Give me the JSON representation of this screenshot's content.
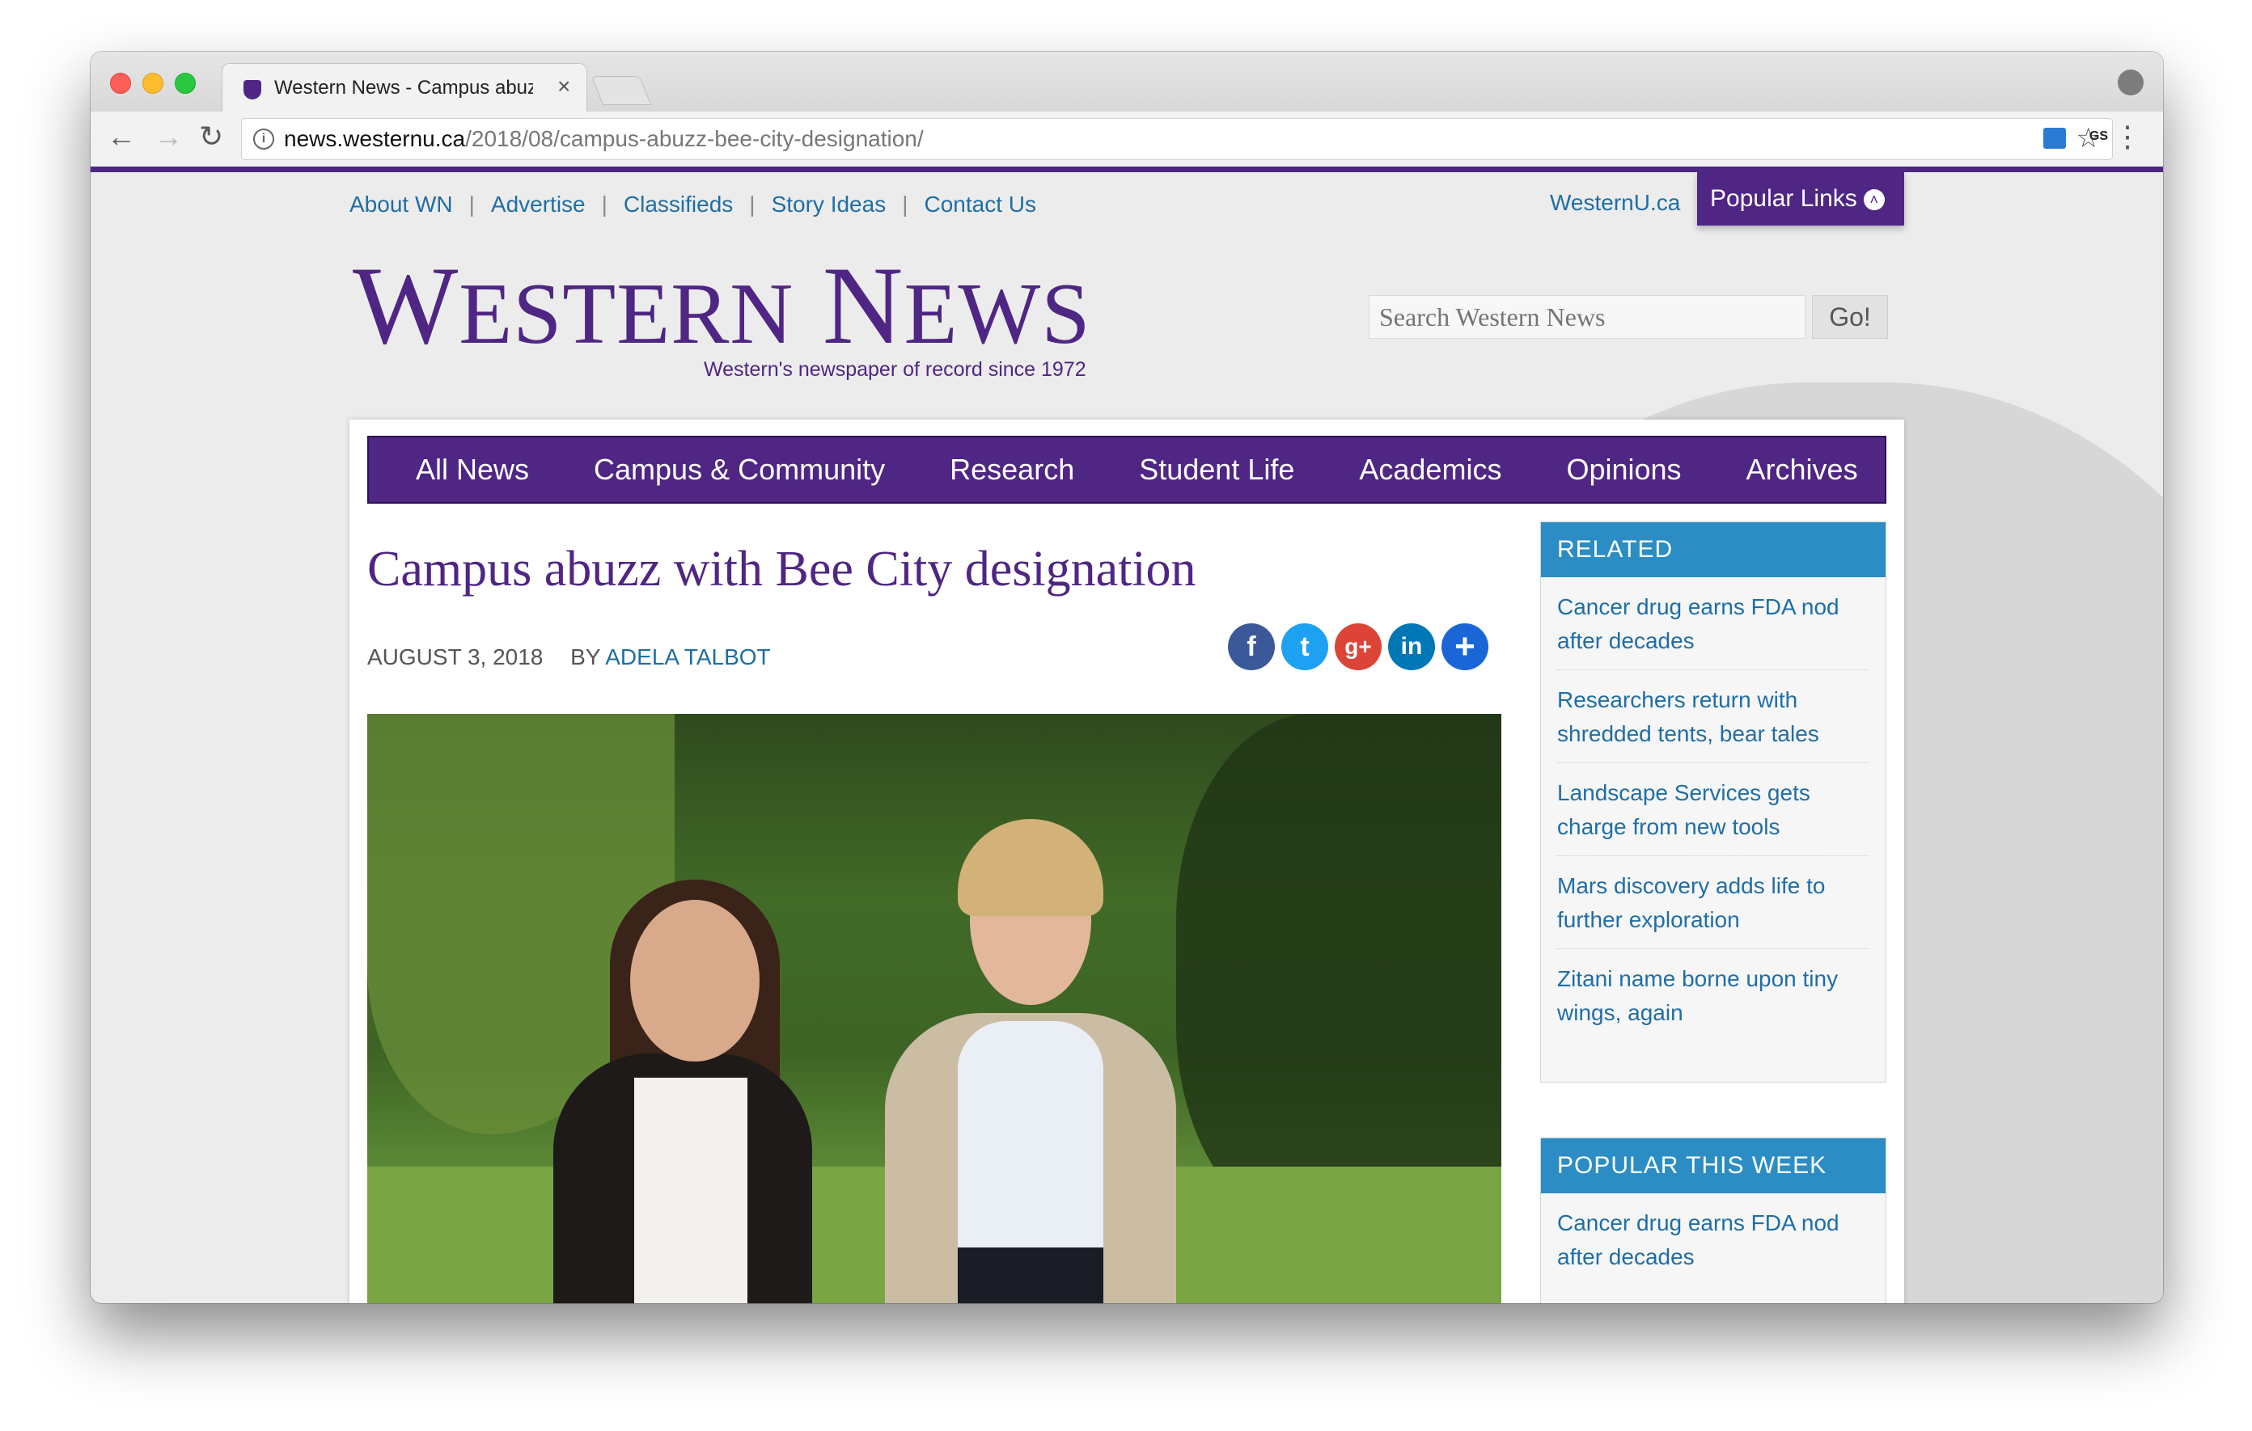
{
  "browser": {
    "tab_title": "Western News - Campus abuzz with Bee City designation",
    "tab_close": "×",
    "url_domain": "news.westernu.ca",
    "url_path": "/2018/08/campus-abuzz-bee-city-designation/",
    "ext_gs_label": "GS"
  },
  "header": {
    "top_links": [
      "About WN",
      "Advertise",
      "Classifieds",
      "Story Ideas",
      "Contact Us"
    ],
    "westernu_link": "WesternU.ca",
    "popular_links": "Popular Links",
    "logo_w": "W",
    "logo_estern": "ESTERN",
    "logo_n": "N",
    "logo_ews": "EWS",
    "tagline": "Western's newspaper of record since 1972",
    "search_placeholder": "Search Western News",
    "search_button": "Go!"
  },
  "nav": [
    "All News",
    "Campus & Community",
    "Research",
    "Student Life",
    "Academics",
    "Opinions",
    "Archives"
  ],
  "article": {
    "headline": "Campus abuzz with Bee City designation",
    "date": "AUGUST 3, 2018",
    "by": "BY",
    "author": "ADELA TALBOT",
    "share_icons": [
      "facebook-icon",
      "twitter-icon",
      "google-plus-icon",
      "linkedin-icon",
      "add-more-icon"
    ]
  },
  "sidebar": {
    "related_title": "RELATED",
    "related": [
      "Cancer drug earns FDA nod after decades",
      "Researchers return with shredded tents, bear tales",
      "Landscape Services gets charge from new tools",
      "Mars discovery adds life to further exploration",
      "Zitani name borne upon tiny wings, again"
    ],
    "popular_title": "POPULAR THIS WEEK",
    "popular": [
      "Cancer drug earns FDA nod after decades"
    ]
  },
  "colors": {
    "brand_purple": "#4f2683",
    "link_blue": "#1f6ea5",
    "widget_blue": "#2b8dc3"
  }
}
